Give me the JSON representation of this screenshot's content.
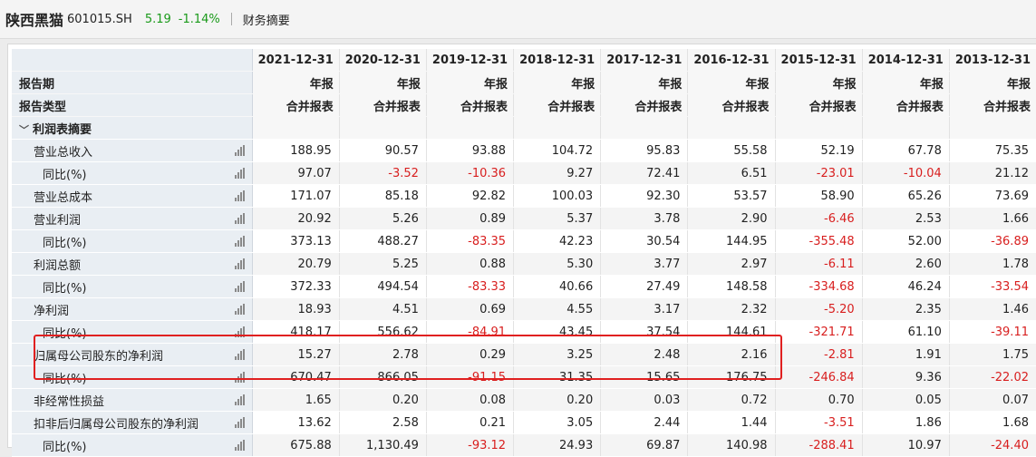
{
  "header": {
    "stock_name": "陕西黑猫",
    "stock_code": "601015.SH",
    "price": "5.19",
    "change": "-1.14%",
    "tab": "财务摘要"
  },
  "table": {
    "dates": [
      "2021-12-31",
      "2020-12-31",
      "2019-12-31",
      "2018-12-31",
      "2017-12-31",
      "2016-12-31",
      "2015-12-31",
      "2014-12-31",
      "2013-12-31"
    ],
    "period_label": "报告期",
    "period_values": [
      "年报",
      "年报",
      "年报",
      "年报",
      "年报",
      "年报",
      "年报",
      "年报",
      "年报"
    ],
    "type_label": "报告类型",
    "type_values": [
      "合并报表",
      "合并报表",
      "合并报表",
      "合并报表",
      "合并报表",
      "合并报表",
      "合并报表",
      "合并报表",
      "合并报表"
    ],
    "section_label": "利润表摘要",
    "rows": [
      {
        "label": "营业总收入",
        "values": [
          "188.95",
          "90.57",
          "93.88",
          "104.72",
          "95.83",
          "55.58",
          "52.19",
          "67.78",
          "75.35"
        ]
      },
      {
        "label": "同比(%)",
        "values": [
          "97.07",
          "-3.52",
          "-10.36",
          "9.27",
          "72.41",
          "6.51",
          "-23.01",
          "-10.04",
          "21.12"
        ]
      },
      {
        "label": "营业总成本",
        "values": [
          "171.07",
          "85.18",
          "92.82",
          "100.03",
          "92.30",
          "53.57",
          "58.90",
          "65.26",
          "73.69"
        ]
      },
      {
        "label": "营业利润",
        "values": [
          "20.92",
          "5.26",
          "0.89",
          "5.37",
          "3.78",
          "2.90",
          "-6.46",
          "2.53",
          "1.66"
        ]
      },
      {
        "label": "同比(%)",
        "values": [
          "373.13",
          "488.27",
          "-83.35",
          "42.23",
          "30.54",
          "144.95",
          "-355.48",
          "52.00",
          "-36.89"
        ]
      },
      {
        "label": "利润总额",
        "values": [
          "20.79",
          "5.25",
          "0.88",
          "5.30",
          "3.77",
          "2.97",
          "-6.11",
          "2.60",
          "1.78"
        ]
      },
      {
        "label": "同比(%)",
        "values": [
          "372.33",
          "494.54",
          "-83.33",
          "40.66",
          "27.49",
          "148.58",
          "-334.68",
          "46.24",
          "-33.54"
        ]
      },
      {
        "label": "净利润",
        "values": [
          "18.93",
          "4.51",
          "0.69",
          "4.55",
          "3.17",
          "2.32",
          "-5.20",
          "2.35",
          "1.46"
        ]
      },
      {
        "label": "同比(%)",
        "values": [
          "418.17",
          "556.62",
          "-84.91",
          "43.45",
          "37.54",
          "144.61",
          "-321.71",
          "61.10",
          "-39.11"
        ]
      },
      {
        "label": "归属母公司股东的净利润",
        "values": [
          "15.27",
          "2.78",
          "0.29",
          "3.25",
          "2.48",
          "2.16",
          "-2.81",
          "1.91",
          "1.75"
        ]
      },
      {
        "label": "同比(%)",
        "values": [
          "670.47",
          "866.05",
          "-91.15",
          "31.35",
          "15.65",
          "176.75",
          "-246.84",
          "9.36",
          "-22.02"
        ]
      },
      {
        "label": "非经常性损益",
        "values": [
          "1.65",
          "0.20",
          "0.08",
          "0.20",
          "0.03",
          "0.72",
          "0.70",
          "0.05",
          "0.07"
        ]
      },
      {
        "label": "扣非后归属母公司股东的净利润",
        "values": [
          "13.62",
          "2.58",
          "0.21",
          "3.05",
          "2.44",
          "1.44",
          "-3.51",
          "1.86",
          "1.68"
        ]
      },
      {
        "label": "同比(%)",
        "values": [
          "675.88",
          "1,130.49",
          "-93.12",
          "24.93",
          "69.87",
          "140.98",
          "-288.41",
          "10.97",
          "-24.40"
        ]
      }
    ]
  },
  "colors": {
    "negative": "#d81e1e",
    "positive_price": "#1a9a1a",
    "highlight_box": "#e02020"
  }
}
